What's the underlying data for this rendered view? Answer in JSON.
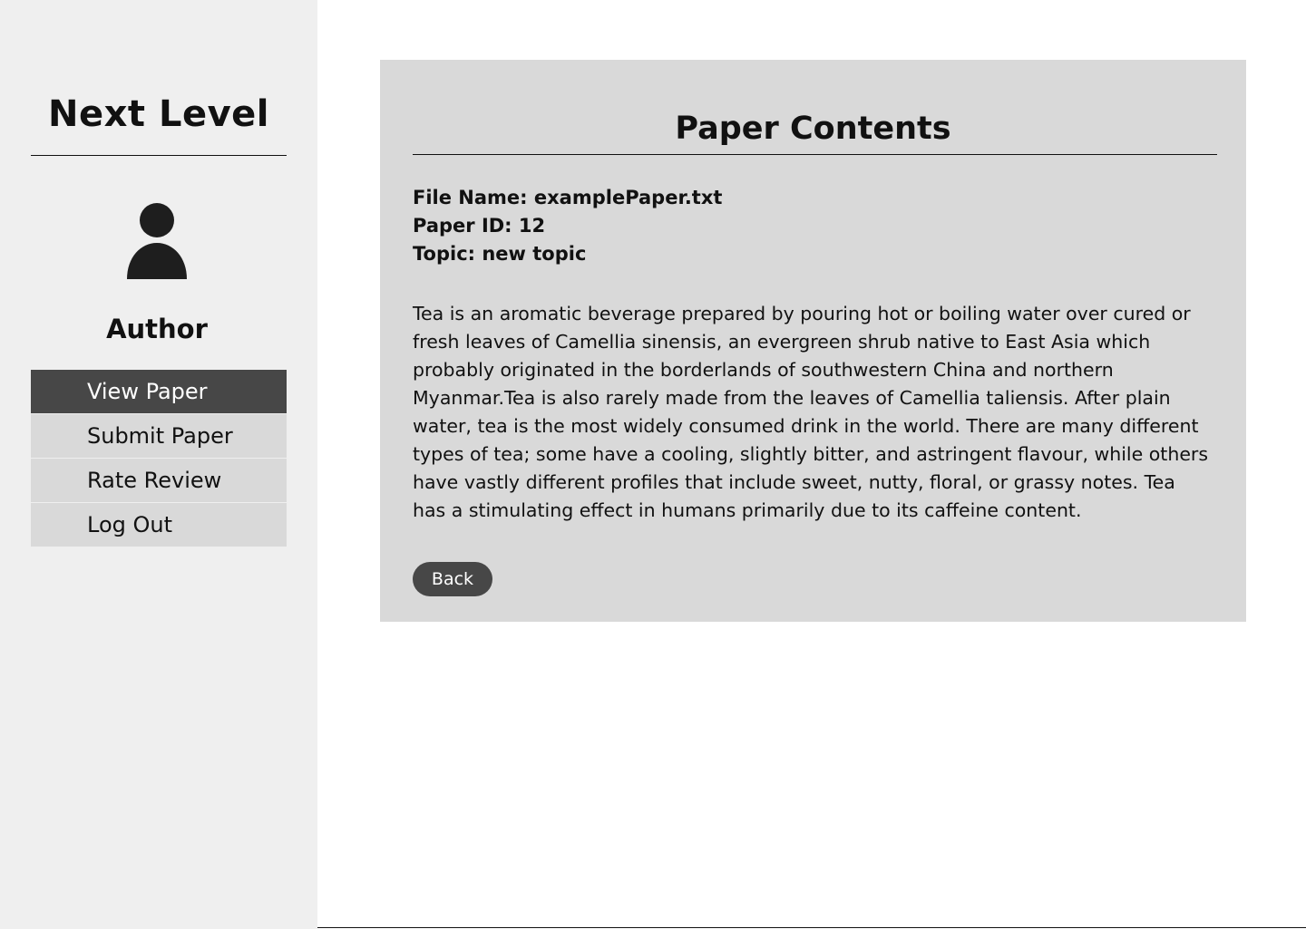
{
  "sidebar": {
    "brand": "Next Level",
    "avatar_icon": "user-icon",
    "role": "Author",
    "items": [
      {
        "label": "View Paper",
        "active": true
      },
      {
        "label": "Submit Paper",
        "active": false
      },
      {
        "label": "Rate Review",
        "active": false
      },
      {
        "label": "Log Out",
        "active": false
      }
    ]
  },
  "main": {
    "title": "Paper Contents",
    "file_name": "File Name: examplePaper.txt",
    "paper_id": "Paper ID: 12",
    "topic": "Topic: new topic",
    "body": "Tea is an aromatic beverage prepared by pouring hot or boiling water over cured or fresh leaves of Camellia sinensis, an evergreen shrub native to East Asia which probably originated in the borderlands of southwestern China and northern Myanmar.Tea is also rarely made from the leaves of Camellia taliensis. After plain water, tea is the most widely consumed drink in the world. There are many different types of tea; some have a cooling, slightly bitter, and astringent flavour, while others have vastly different profiles that include sweet, nutty, floral, or grassy notes. Tea has a stimulating effect in humans primarily due to its caffeine content.",
    "back_label": "Back"
  },
  "colors": {
    "sidebar_bg": "#efefef",
    "panel_bg": "#d9d9d9",
    "active_bg": "#474747",
    "text": "#111111"
  }
}
